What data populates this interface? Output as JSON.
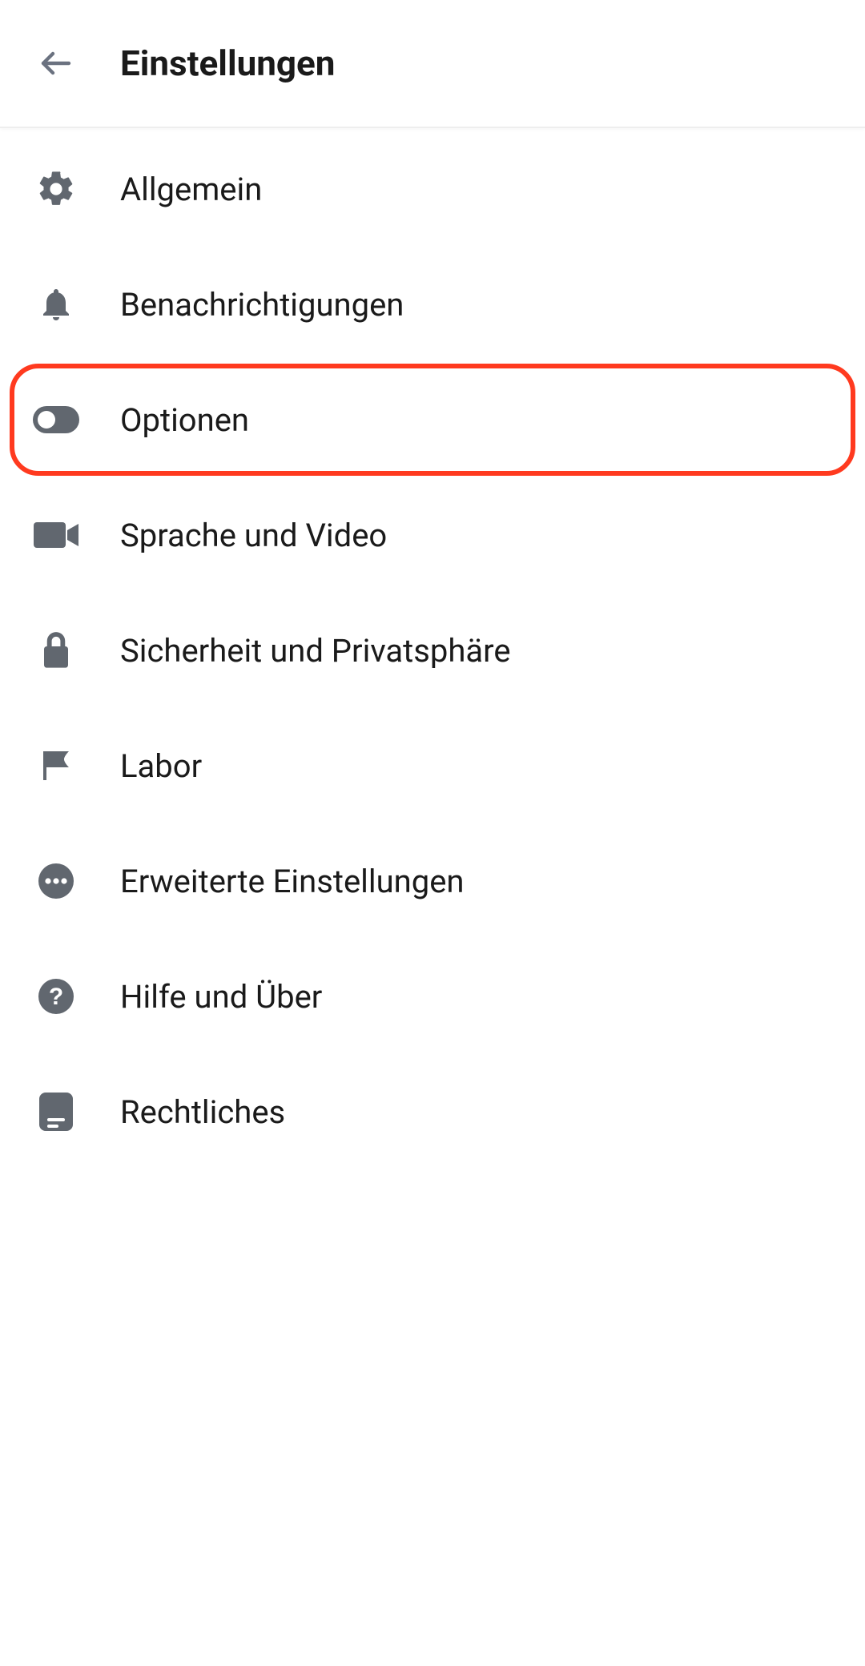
{
  "header": {
    "title": "Einstellungen"
  },
  "items": [
    {
      "label": "Allgemein"
    },
    {
      "label": "Benachrichtigungen"
    },
    {
      "label": "Optionen"
    },
    {
      "label": "Sprache und Video"
    },
    {
      "label": "Sicherheit und Privatsphäre"
    },
    {
      "label": "Labor"
    },
    {
      "label": "Erweiterte Einstellungen"
    },
    {
      "label": "Hilfe und Über"
    },
    {
      "label": "Rechtliches"
    }
  ],
  "highlighted_index": 2
}
